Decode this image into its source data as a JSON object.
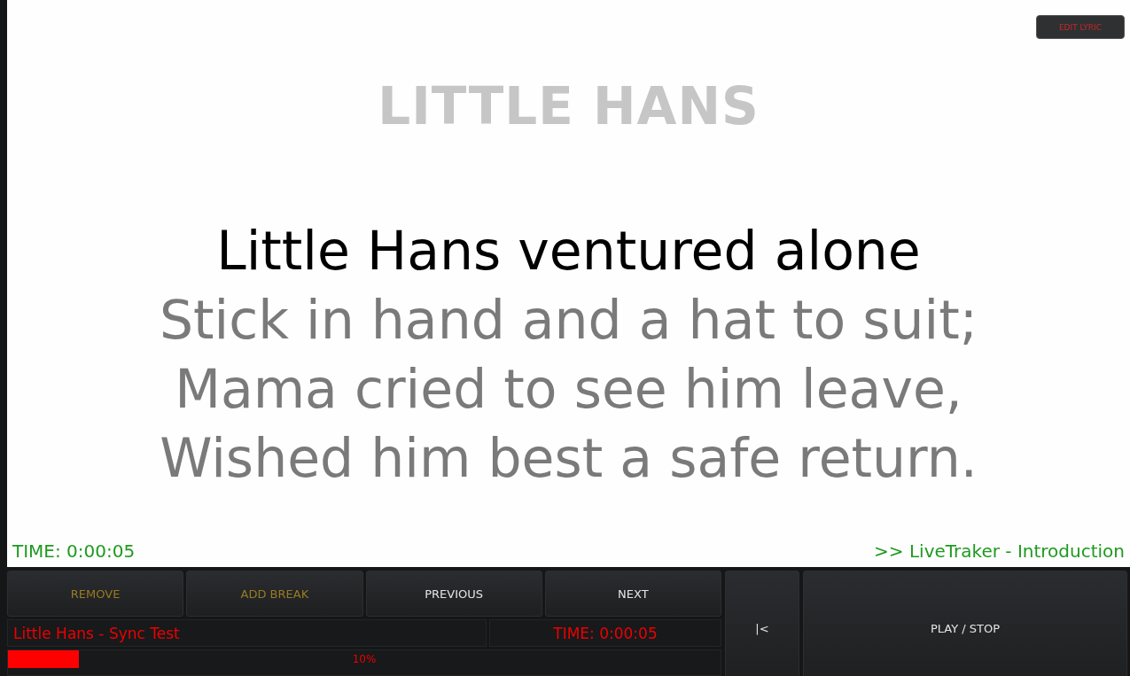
{
  "edit_button": "EDIT LYRIC",
  "song_title": "LITTLE HANS",
  "lyrics": [
    {
      "text": "Little Hans ventured alone",
      "current": true
    },
    {
      "text": "Stick in hand and a hat to suit;",
      "current": false
    },
    {
      "text": "Mama cried to see him leave,",
      "current": false
    },
    {
      "text": "Wished him best a safe return.",
      "current": false
    }
  ],
  "time": "TIME: 0:00:05",
  "section": ">> LiveTraker - Introduction",
  "controls": [
    {
      "label": "REMOVE",
      "disabled": true
    },
    {
      "label": "ADD BREAK",
      "disabled": true
    },
    {
      "label": "PREVIOUS",
      "disabled": false
    },
    {
      "label": "NEXT",
      "disabled": false
    }
  ],
  "track_name": "Little Hans - Sync Test",
  "track_time": "TIME: 0:00:05",
  "progress": {
    "level": 0.1,
    "reading": "10%"
  },
  "rewind_button": "|<",
  "play_button": "PLAY / STOP"
}
